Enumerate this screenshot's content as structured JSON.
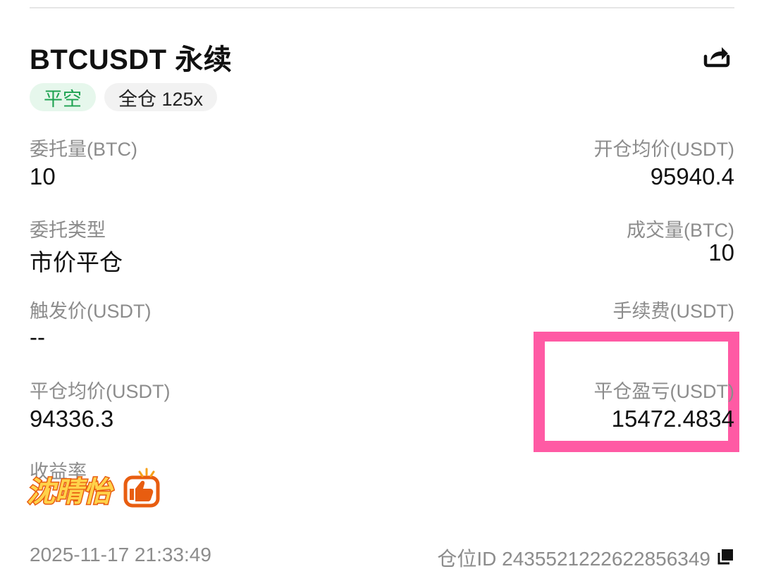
{
  "header": {
    "title": "BTCUSDT 永续",
    "tags": [
      "平空",
      "全仓 125x"
    ]
  },
  "rows": [
    {
      "left": {
        "label": "委托量(BTC)",
        "value": "10"
      },
      "right": {
        "label": "开仓均价(USDT)",
        "value": "95940.4"
      }
    },
    {
      "left": {
        "label": "委托类型",
        "value": "市价平仓"
      },
      "right": {
        "label": "成交量(BTC)",
        "value": "10"
      }
    },
    {
      "left": {
        "label": "触发价(USDT)",
        "value": "--"
      },
      "right": {
        "label": "手续费(USDT)",
        "value": ""
      }
    },
    {
      "left": {
        "label": "平仓均价(USDT)",
        "value": "94336.3"
      },
      "right": {
        "label": "平仓盈亏(USDT)",
        "value": "15472.4834"
      }
    }
  ],
  "yield_label": "收益率",
  "watermark_text": "沈晴怡",
  "footer": {
    "timestamp": "2025-11-17 21:33:49",
    "position_id": "仓位ID 2435521222622856349"
  },
  "icons": {
    "share": "share-icon",
    "copy": "copy-icon",
    "thumb": "thumbs-up-icon"
  },
  "colors": {
    "tag_green": "#1fa352",
    "highlight": "#ff5aa4",
    "watermark": "#f7a21b"
  }
}
